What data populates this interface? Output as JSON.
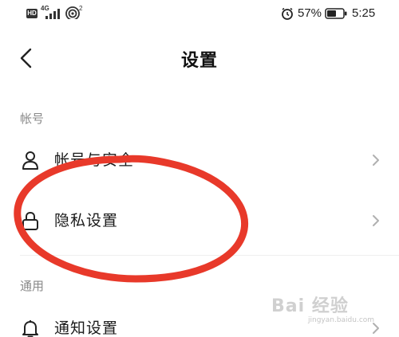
{
  "status_bar": {
    "hd": "HD",
    "network": "4G",
    "wifi_sup": "2",
    "battery_percent": "57%",
    "time": "5:25",
    "icons": [
      "signal-icon",
      "wifi-icon",
      "alarm-icon",
      "battery-icon"
    ]
  },
  "header": {
    "title": "设置",
    "back_icon": "chevron-left-icon"
  },
  "sections": {
    "account": {
      "label": "帐号",
      "items": [
        {
          "label": "帐号与安全",
          "icon": "person-icon"
        },
        {
          "label": "隐私设置",
          "icon": "lock-icon"
        }
      ]
    },
    "general": {
      "label": "通用",
      "items": [
        {
          "label": "通知设置",
          "icon": "bell-icon"
        }
      ]
    }
  },
  "annotation": {
    "color": "#e8392a",
    "target": "隐私设置"
  },
  "watermark": {
    "main": "Bai 经验",
    "sub": "jingyan.baidu.com"
  },
  "colors": {
    "text": "#1a1a1a",
    "section_label": "#8a8a8a",
    "chevron": "#b0b0b0"
  }
}
